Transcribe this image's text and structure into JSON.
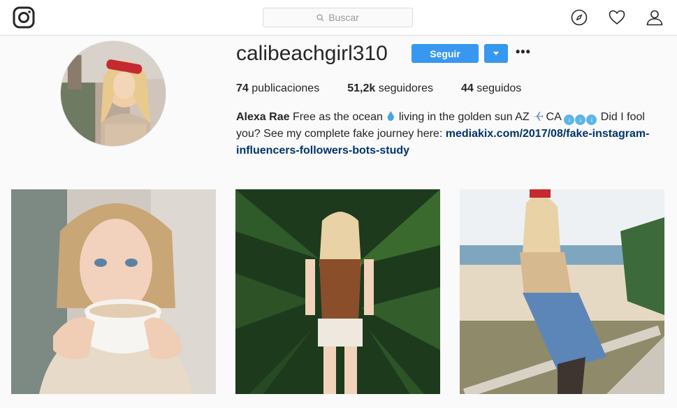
{
  "nav": {
    "search_placeholder": "Buscar",
    "icons": [
      "instagram-logo-icon",
      "search-icon",
      "compass-icon",
      "heart-icon",
      "person-icon"
    ]
  },
  "profile": {
    "username": "calibeachgirl310",
    "follow_label": "Seguir",
    "more_label": "•••",
    "stats": {
      "posts_count": "74",
      "posts_label": "publicaciones",
      "followers_count": "51,2k",
      "followers_label": "seguidores",
      "following_count": "44",
      "following_label": "seguidos"
    },
    "bio": {
      "name": "Alexa Rae",
      "text_a": "Free as the ocean",
      "text_b": "living in the golden sun AZ",
      "text_c": "CA",
      "text_d": "Did I fool you? See my complete fake journey here:",
      "link": "mediakix.com/2017/08/fake-instagram-influencers-followers-bots-study"
    }
  },
  "colors": {
    "accent": "#3897f0",
    "link": "#003569",
    "background": "#fafafa",
    "border": "#dbdbdb"
  }
}
